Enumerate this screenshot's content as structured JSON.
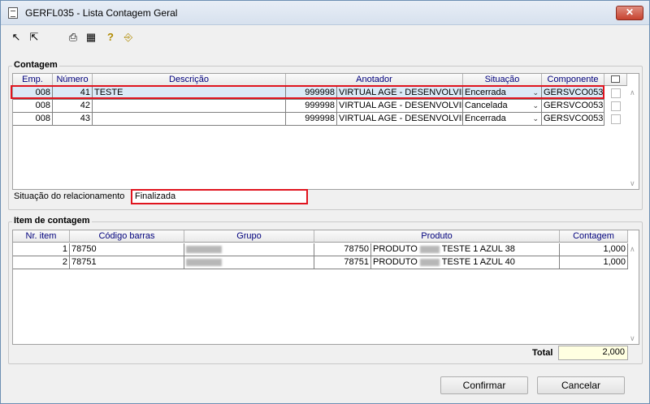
{
  "window": {
    "title": "GERFL035 - Lista Contagem Geral",
    "close_glyph": "✕"
  },
  "toolbar": {
    "items": [
      {
        "icon": "arrow-select-icon",
        "glyph": "↖"
      },
      {
        "icon": "double-arrow-icon",
        "glyph": "⇱"
      },
      {
        "icon": "printer-icon",
        "glyph": "⎙"
      },
      {
        "icon": "calendar-grid-icon",
        "glyph": "▦"
      },
      {
        "icon": "help-icon",
        "glyph": "?"
      },
      {
        "icon": "exit-door-icon",
        "glyph": "⎆"
      }
    ]
  },
  "contagem": {
    "label": "Contagem",
    "headers": [
      "Emp.",
      "Número",
      "Descrição",
      "Anotador",
      "Situação",
      "Componente"
    ],
    "rows": [
      {
        "emp": "008",
        "numero": "41",
        "descricao": "TESTE",
        "anot_cod": "999998",
        "anot_nome": "VIRTUAL AGE - DESENVOLVIM",
        "situacao": "Encerrada",
        "componente": "GERSVCO053"
      },
      {
        "emp": "008",
        "numero": "42",
        "descricao": "",
        "anot_cod": "999998",
        "anot_nome": "VIRTUAL AGE - DESENVOLVIM",
        "situacao": "Cancelada",
        "componente": "GERSVCO053"
      },
      {
        "emp": "008",
        "numero": "43",
        "descricao": "",
        "anot_cod": "999998",
        "anot_nome": "VIRTUAL AGE - DESENVOLVIM",
        "situacao": "Encerrada",
        "componente": "GERSVCO053"
      }
    ],
    "relacionamento_label": "Situação do relacionamento",
    "relacionamento_value": "Finalizada"
  },
  "itens": {
    "label": "Item de contagem",
    "headers": [
      "Nr. item",
      "Código barras",
      "Grupo",
      "Produto",
      "Contagem"
    ],
    "rows": [
      {
        "nr": "1",
        "codigo": "78750",
        "prod_cod": "78750",
        "prod_pre": "PRODUTO",
        "prod_pos": "TESTE 1 AZUL 38",
        "contagem": "1,000"
      },
      {
        "nr": "2",
        "codigo": "78751",
        "prod_cod": "78751",
        "prod_pre": "PRODUTO",
        "prod_pos": "TESTE 1 AZUL 40",
        "contagem": "1,000"
      }
    ],
    "total_label": "Total",
    "total_value": "2,000"
  },
  "buttons": {
    "confirmar": "Confirmar",
    "cancelar": "Cancelar"
  },
  "colors": {
    "highlight_red": "#e0141e",
    "header_text": "#00007c",
    "selected_row": "#dbeaf7",
    "total_bg": "#ffffe1"
  }
}
